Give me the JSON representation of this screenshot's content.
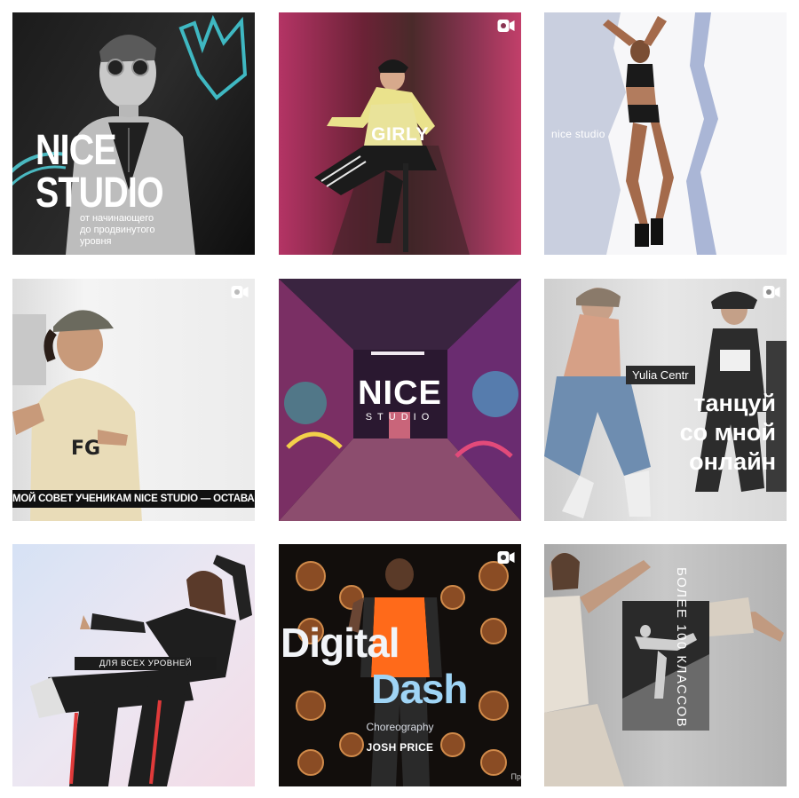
{
  "posts": [
    {
      "id_label": "nice-studio-post",
      "is_video": false,
      "title_lines": [
        "NICE",
        "STUDIO"
      ],
      "subtitle_lines": [
        "от начинающего",
        "до продвинутого",
        "уровня"
      ]
    },
    {
      "is_video": true,
      "caption": "GIRLY"
    },
    {
      "is_video": false,
      "caption": "nice studio"
    },
    {
      "is_video": true,
      "caption": "МОЙ СОВЕТ УЧЕНИКАМ NICE STUDIO — ОСТАВАЙТЕСЬ СОБОЙ",
      "cap_text": "FG"
    },
    {
      "is_video": false,
      "title": "NICE",
      "subtitle": "STUDIO"
    },
    {
      "is_video": true,
      "name_tag": "Yulia Centr",
      "title_lines": [
        "танцуй",
        "со мной",
        "онлайн"
      ]
    },
    {
      "is_video": false,
      "caption": "ДЛЯ ВСЕХ УРОВНЕЙ"
    },
    {
      "is_video": true,
      "title_word1": "Digital",
      "title_word2": "Dash",
      "subtitle": "Choreography",
      "author": "JOSH PRICE",
      "corner_text": "Пр"
    },
    {
      "is_video": false,
      "vertical_text": "БОЛЕЕ 100 КЛАССОВ"
    }
  ],
  "colors": {
    "background": "#ffffff",
    "video_icon": "#ffffff"
  },
  "icons": {
    "video": "video-camera-icon"
  }
}
